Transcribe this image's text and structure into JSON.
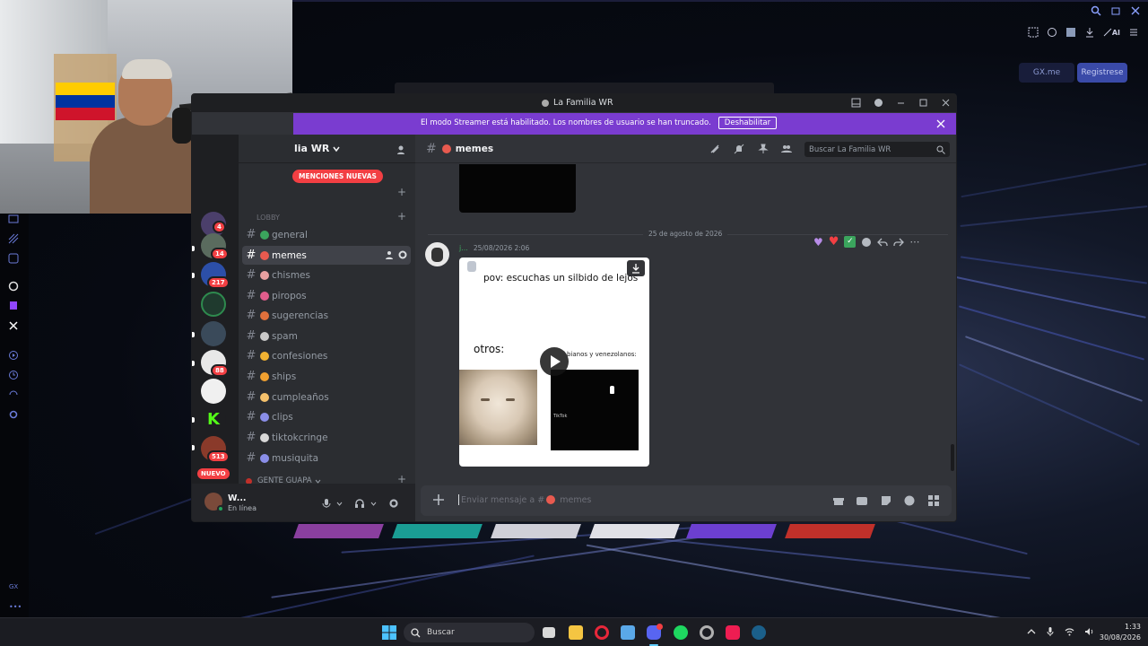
{
  "discord": {
    "window_title": "La Familia WR",
    "banner": {
      "text": "El modo Streamer está habilitado. Los nombres de usuario se han truncado.",
      "button": "Deshabilitar"
    },
    "server_name": "lia WR",
    "mentions_pill": "MENCIONES NUEVAS",
    "category_partial": "Lobby",
    "category_bottom": "GENTE GUAPA",
    "new_pill": "NUEVO",
    "channels": [
      {
        "label": "general",
        "color": "#3ba55d"
      },
      {
        "label": "memes",
        "color": "#e85a4f"
      },
      {
        "label": "chismes",
        "color": "#e8a0a0"
      },
      {
        "label": "piropos",
        "color": "#e05d8c"
      },
      {
        "label": "sugerencias",
        "color": "#e0703c"
      },
      {
        "label": "spam",
        "color": "#c9c9c9"
      },
      {
        "label": "confesiones",
        "color": "#f0b232"
      },
      {
        "label": "ships",
        "color": "#f0a030"
      },
      {
        "label": "cumpleaños",
        "color": "#f5c16c"
      },
      {
        "label": "clips",
        "color": "#8a8ee8"
      },
      {
        "label": "tiktokcringe",
        "color": "#d8d8d8"
      },
      {
        "label": "musiquita",
        "color": "#8a8ee8"
      }
    ],
    "guild_badges": [
      "4",
      "14",
      "217",
      "88",
      "513"
    ],
    "header": {
      "channel": "memes",
      "search_placeholder": "Buscar La Familia WR"
    },
    "date_divider": "25 de agosto de 2026",
    "message": {
      "author": "j...",
      "timestamp": "25/08/2026 2:06",
      "video_text_1": "pov: escuchas un silbido de lejos",
      "video_text_2": "otros:",
      "video_text_3": "bianos y venezolanos:",
      "tiktok_label": "TikTok"
    },
    "reactions": [
      "purple-heart",
      "red-heart",
      "check-mark"
    ],
    "user_panel": {
      "name": "W...",
      "status": "En línea"
    },
    "input_placeholder": "Enviar mensaje a #",
    "input_channel": "memes"
  },
  "browser": {
    "pill_left": "GX.me",
    "pill_right": "Registrese",
    "ai_label": "AI",
    "left_label": "GX"
  },
  "taskbar": {
    "search": "Buscar",
    "time": "1:33",
    "date": "30/08/2026"
  },
  "colors": {
    "blurple": "#5865f2",
    "streamer_banner": "#7a3cd0",
    "red_badge": "#f23f43",
    "online": "#23a55a"
  }
}
